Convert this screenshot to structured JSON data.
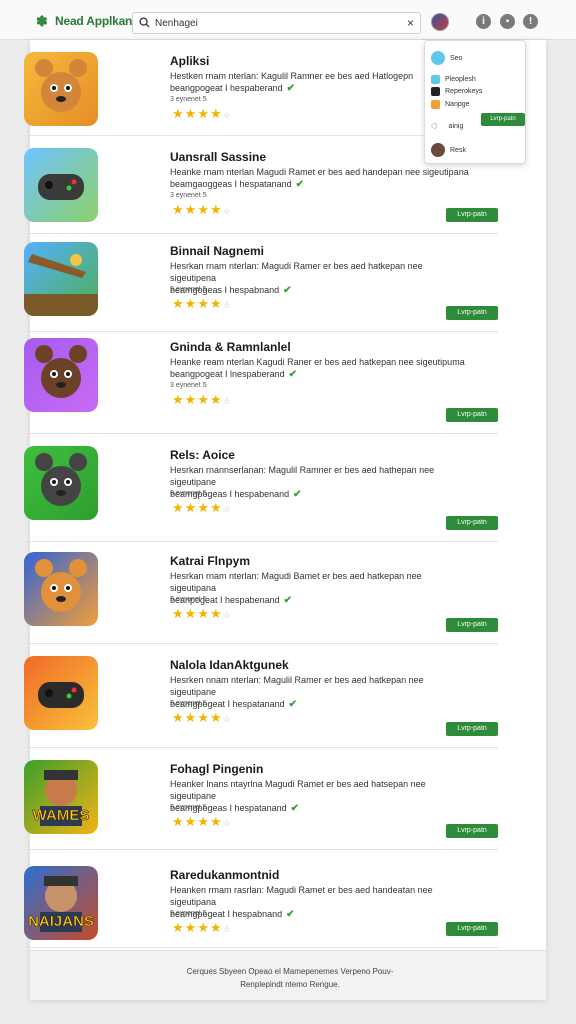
{
  "header": {
    "brand": "Nead Applkan",
    "search_value": "Nenhagei",
    "search_placeholder": "Nenhagei"
  },
  "apps": [
    {
      "title": "Apliksi",
      "desc_line1": "Hestken rnam nterlan: Kagulil Ramner ee bes aed Hatlogepn",
      "desc_line2": "beangpogeat I hespaberand",
      "meta": "3 eynenet 5"
    },
    {
      "title": "Uansrall Sassine",
      "desc_line1": "Heanke rnam nterlan Magudi Ramet er bes aed handepan nee sigeutipana",
      "desc_line2": "beamgaoggeas I hespatanand",
      "meta": "3 eynenet 5"
    },
    {
      "title": "Binnail Nagnemi",
      "desc_line1": "Hesrkan rnam nterlan: Magudi Ramer er bes aed hatkepan nee sigeutipena",
      "desc_line2": "beamgogeas I hespabnand",
      "meta": "3 eynenet 5"
    },
    {
      "title": "Gninda & Ramnlanlel",
      "desc_line1": "Heanke ream nterlan Kagudi Raner er bes aed hatkepan nee sigeutipuma",
      "desc_line2": "beangpogeat I lnespaberand",
      "meta": "3 eynenet 5"
    },
    {
      "title": "Rels: Aoice",
      "desc_line1": "Hesrkan rnannserlanan: Magulil Ramner er bes aed hathepan nee sigeutipane",
      "desc_line2": "beamgpogeas I hespabenand",
      "meta": "3 eynenet 5"
    },
    {
      "title": "Katrai Flnpym",
      "desc_line1": "Hesrkan rnam nterlan: Magudi Bamet er bes aed hatkepan nee sigeutipana",
      "desc_line2": "beanpogeat I hespabenand",
      "meta": "3 eynenet 5"
    },
    {
      "title": "Nalola IdanAktgunek",
      "desc_line1": "Hesrken nnam nterlan: Magulil Ramer er bes aed hatkepan nee sigeutipane",
      "desc_line2": "beamgpogeat I hespatanand",
      "meta": "3 eynenet 5"
    },
    {
      "title": "Fohagl Pingenin",
      "desc_line1": "Heanker lnans ntayrlna Magudi Ramet er bes aed hatsepan nee sigeutipane",
      "desc_line2": "beamgpogeas I hespatanand",
      "meta": "3 eynenet 5"
    },
    {
      "title": "Raredukanmontnid",
      "desc_line1": "Heanken rmam rasrlan: Magudi Ramet er bes aed handeatan nee sigeutipana",
      "desc_line2": "beamgpogeat I hespabnand",
      "meta": "3 eynenet 5"
    }
  ],
  "get_label": "Lvrp-patn",
  "icon_texts": {
    "wames": "WAMES",
    "naijans": "NAIJANS"
  },
  "dropdown": {
    "items": [
      "Seo",
      "Pleoplesh",
      "Reperokeys",
      "Nanpge",
      "ainig",
      "Resk"
    ],
    "button": "Lvrp-patn"
  },
  "footer": {
    "line1": "Cerques Sbyeen Opeao el Mamepenemes Verpeno Pouv-",
    "line2": "Renplepindt ntemo Rengue."
  },
  "colors": {
    "accent": "#2e8b3a",
    "star": "#f1b400"
  }
}
